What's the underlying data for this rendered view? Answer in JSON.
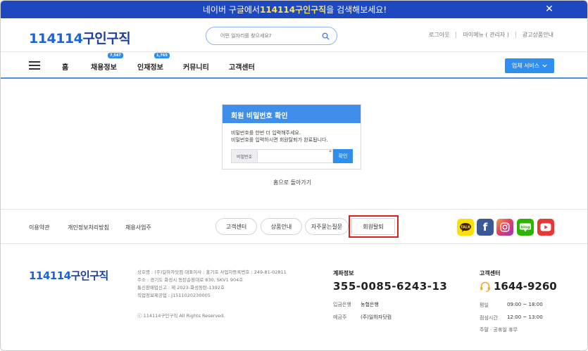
{
  "banner": {
    "text_before": "네이버 구글에서 ",
    "highlight": "114114구인구직",
    "text_after": "을 검색해보세요!",
    "close": "✕"
  },
  "header": {
    "logo_num": "114114",
    "logo_text": "구인구직",
    "search_placeholder": "어떤 일자리를 찾으세요?",
    "links": [
      "로그아웃",
      "마이메뉴 ( 관리자 )",
      "광고상품안내"
    ]
  },
  "nav": {
    "items": [
      {
        "label": "홈",
        "badge": ""
      },
      {
        "label": "채용정보",
        "badge": "7,547"
      },
      {
        "label": "인재정보",
        "badge": "1,765"
      },
      {
        "label": "커뮤니티",
        "badge": ""
      },
      {
        "label": "고객센터",
        "badge": ""
      }
    ],
    "biz_button": "업체 서비스"
  },
  "password_card": {
    "title": "회원 비밀번호 확인",
    "desc_line1": "비밀번호를 한번 더 입력해주세요.",
    "desc_line2": "비밀번호를 입력하시면 회원탈퇴가 완료됩니다.",
    "field_label": "비밀번호",
    "required_mark": "*",
    "confirm_button": "확인"
  },
  "home_back": "홈으로 돌아가기",
  "footer_nav": {
    "links": [
      "이용약관",
      "개인정보처리방침",
      "채용사업주"
    ],
    "pills": [
      "고객센터",
      "상품안내",
      "자주묻는질문",
      "회원탈퇴"
    ],
    "sns": [
      {
        "name": "kakao",
        "label": "TALK",
        "color": "#fae100"
      },
      {
        "name": "facebook",
        "label": "f",
        "color": "#3b5998"
      },
      {
        "name": "instagram",
        "label": "",
        "color": "#d6249f"
      },
      {
        "name": "blog",
        "label": "blog",
        "color": "#2db400"
      },
      {
        "name": "youtube",
        "label": "",
        "color": "#e53935"
      }
    ]
  },
  "footer_info": {
    "logo_num": "114114",
    "logo_text": "구인구직",
    "lines": [
      "상호명 : (주)일하자닷컴 대표이사 : 홍기호 사업자등록번호 : 249-81-02811",
      "주소 : 경기도 화성시 동탄순환대로 830, SKV1 904호",
      "통신판매업신고 : 제 2023-화성동탄-1392호",
      "직업정보제공업 : J1511020230005"
    ],
    "copyright": "ⓒ 114114구인구직 All Rights Reserved."
  },
  "account": {
    "title": "계좌정보",
    "number": "355-0085-6243-13",
    "bank_label": "입금은행",
    "bank_value": "농협은행",
    "holder_label": "예금주",
    "holder_value": "(주)일하자닷컴"
  },
  "customer_service": {
    "title": "고객센터",
    "phone": "1644-9260",
    "weekday_label": "평일",
    "weekday_value": "09:00 ~ 18:00",
    "lunch_label": "점심시간",
    "lunch_value": "12:00 ~ 13:00",
    "weekend_text": "주말 · 공휴일 휴무"
  },
  "colors": {
    "banner_bg": "#1e48c0",
    "accent": "#2f8ff0",
    "highlight_border": "#e31b1b"
  }
}
